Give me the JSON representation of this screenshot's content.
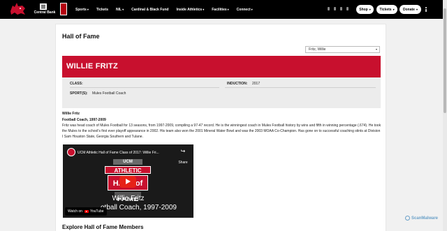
{
  "header": {
    "sponsor_text": "Central Bank",
    "nav": [
      {
        "label": "Sports",
        "caret": "▾"
      },
      {
        "label": "Tickets",
        "caret": ""
      },
      {
        "label": "NIL",
        "caret": "▾"
      },
      {
        "label": "Cardinal & Black Fund",
        "caret": ""
      },
      {
        "label": "Inside Athletics",
        "caret": "▾"
      },
      {
        "label": "Facilities",
        "caret": "▾"
      },
      {
        "label": "Connect",
        "caret": "▾"
      }
    ],
    "buttons": {
      "shop": "Shop",
      "tickets": "Tickets",
      "donate": "Donate"
    }
  },
  "page": {
    "title": "Hall of Fame",
    "select_value": "Fritz, Willie",
    "inductee_name": "WILLIE FRITZ",
    "class_label": "CLASS:",
    "class_value": "",
    "induction_label": "INDUCTION:",
    "induction_value": "2017",
    "sports_label": "SPORT(S):",
    "sports_value": "Mules Football Coach",
    "bio_name": "Willie Fritz",
    "bio_role": "Football Coach, 1997-2009",
    "bio_text": "Fritz was head coach of Mules Football for 13 seasons, from 1997-2009, compiling a 97-47 record. He is the winningest coach in Mules Football history by wins and fifth in winning percentage (.674). He took the Mules to the school's first ever playoff appearance in 2002. His team also won the 2001 Mineral Water Bowl and was the 2003 MOAA Co-Champion. Has gone on to successful coaching stints at Division I Sam Houston State, Georgia Southern and Tulane.",
    "explore_heading": "Explore Hall of Fame Members"
  },
  "video": {
    "title": "UCM Athletic Hall of Fame Class of 2017: Willie Fri...",
    "share_label": "Share",
    "logo_top": "UCM",
    "logo_athletic": "ATHLETIC",
    "logo_hof": "HALL of FAME",
    "line1": "Willie Fritz",
    "line2": "otball Coach, 1997-2009",
    "watch_on": "Watch on",
    "youtube": "YouTube"
  },
  "watermark": "ScanMalware",
  "colors": {
    "brand_red": "#c8102e",
    "header_bg": "#000000"
  }
}
